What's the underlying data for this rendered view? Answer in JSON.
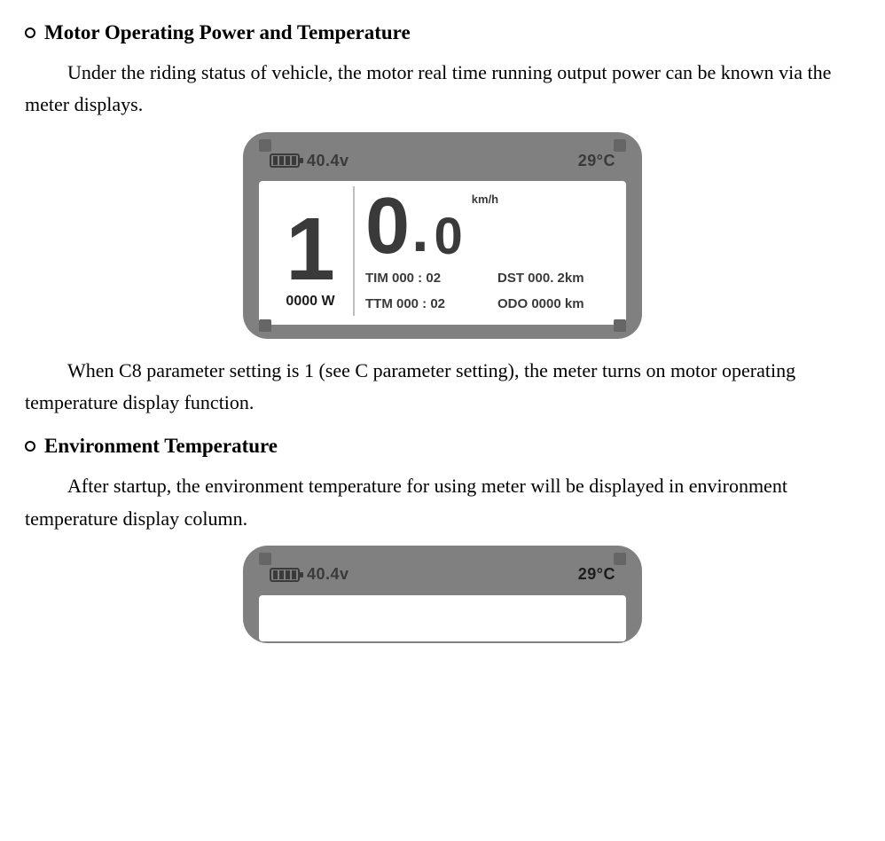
{
  "section1": {
    "heading": "Motor Operating Power and Temperature",
    "para1": "Under the riding status of vehicle, the motor real time running output power can be known via the meter displays.",
    "para2": "When C8 parameter setting is 1 (see C parameter setting), the meter turns on motor operating temperature display function."
  },
  "section2": {
    "heading": "Environment Temperature",
    "para1": "After startup, the environment temperature for using meter will be displayed in environment temperature display column."
  },
  "meter1": {
    "batteryVoltage": "40.4v",
    "temperature": "29°C",
    "pasLevel": "1",
    "power": "0000 W",
    "speedMajor": "0",
    "speedMinor": "0",
    "speedUnit": "km/h",
    "tim": "TIM 000 : 02",
    "dst": "DST 000. 2km",
    "ttm": "TTM 000 : 02",
    "odo": "ODO 0000 km"
  },
  "meter2": {
    "batteryVoltage": "40.4v",
    "temperature": "29°C"
  }
}
